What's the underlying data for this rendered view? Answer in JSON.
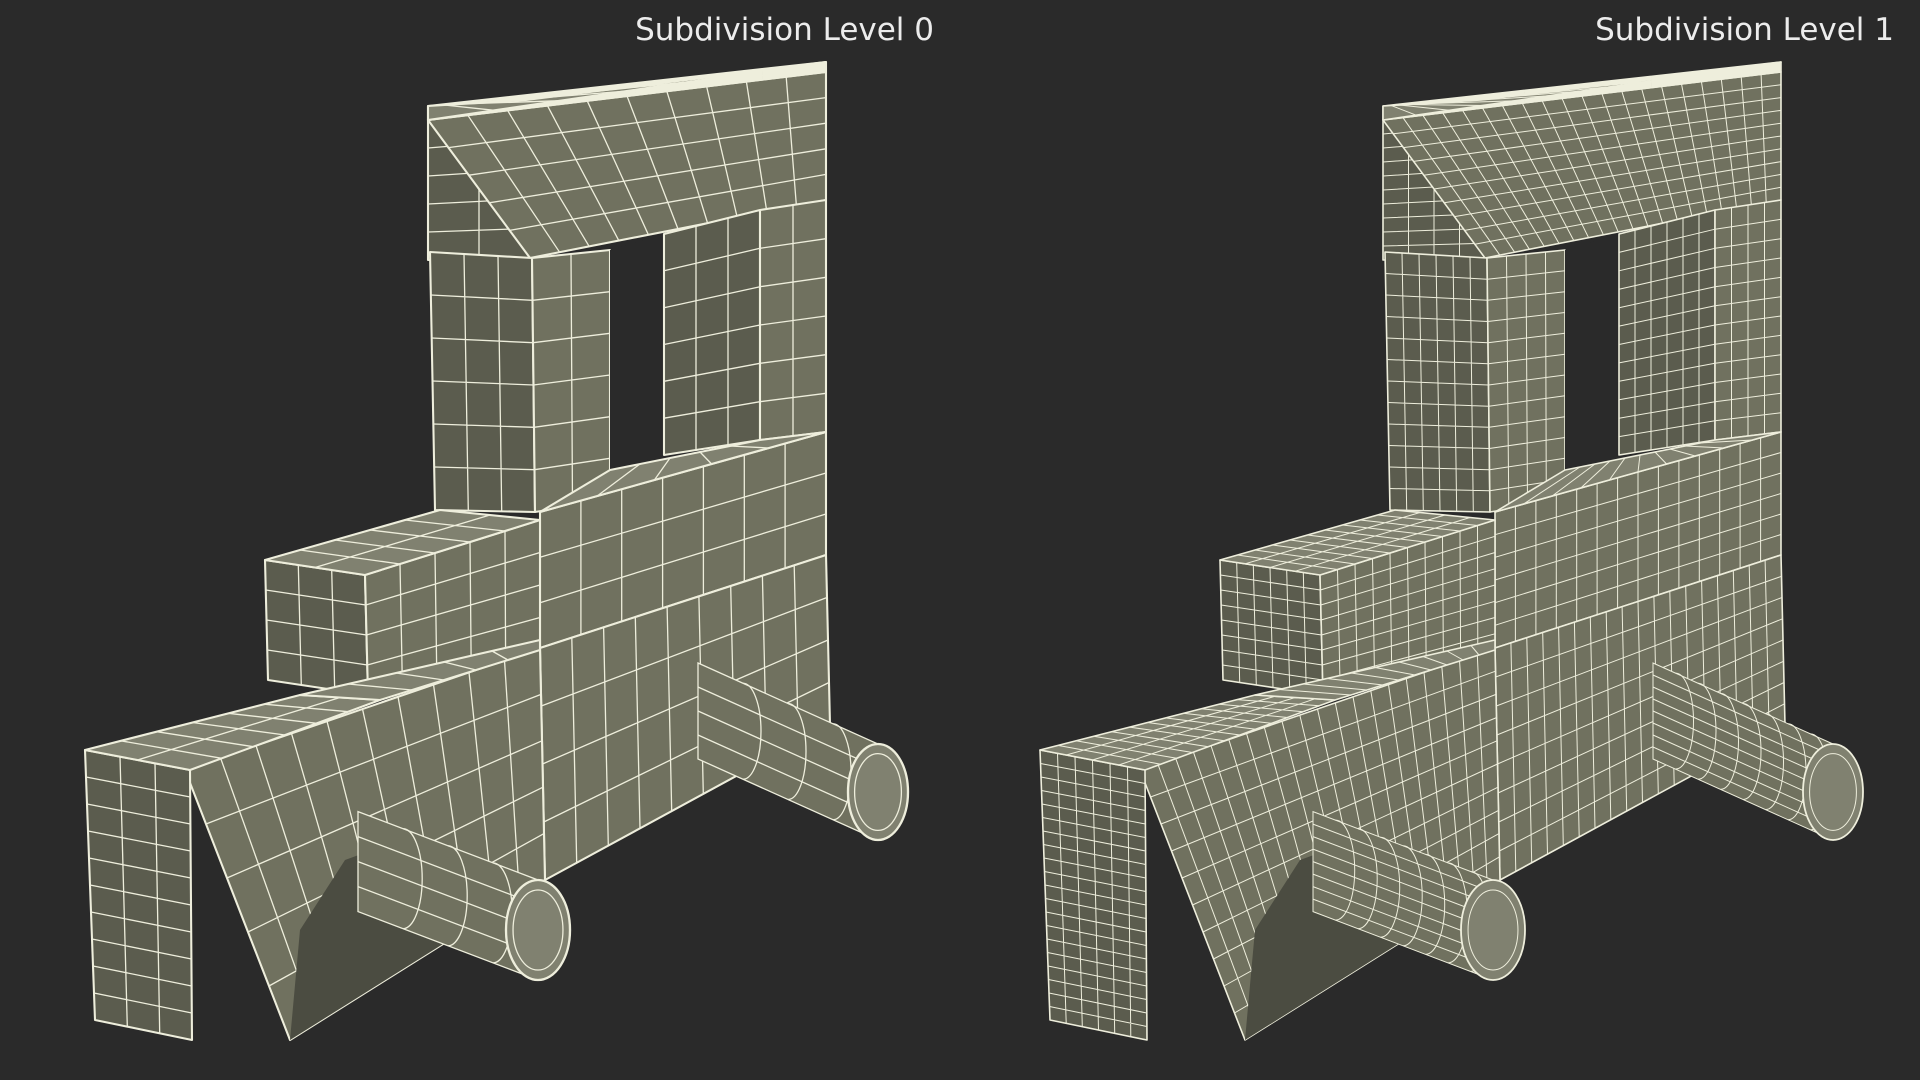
{
  "labels": {
    "left": "Subdivision Level 0",
    "right": "Subdivision Level 1"
  },
  "colors": {
    "background": "#2a2a2a",
    "face_front": "#70715f",
    "face_side": "#5b5c4e",
    "face_top": "#808170",
    "face_dark": "#4b4c41",
    "wire": "#eeeedc",
    "label": "#ececec"
  },
  "models": [
    {
      "name": "model-subdivision-level-0",
      "grid_density": 1
    },
    {
      "name": "model-subdivision-level-1",
      "grid_density": 2
    }
  ]
}
